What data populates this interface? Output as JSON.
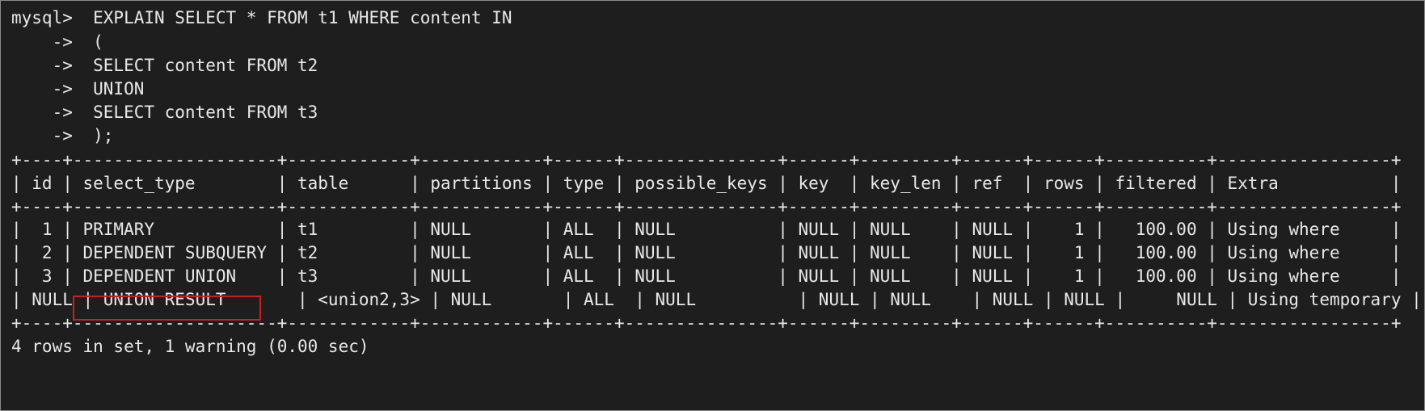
{
  "terminal": {
    "prompt_lines": [
      "mysql>  EXPLAIN SELECT * FROM t1 WHERE content IN",
      "    ->  (",
      "    ->  SELECT content FROM t2",
      "    ->  UNION",
      "    ->  SELECT content FROM t3",
      "    ->  );"
    ],
    "table": {
      "border_top": "+----+--------------------+------------+------------+------+---------------+------+---------+------+------+----------+-----------------+",
      "header": "| id | select_type        | table      | partitions | type | possible_keys | key  | key_len | ref  | rows | filtered | Extra           |",
      "border_mid": "+----+--------------------+------------+------------+------+---------------+------+---------+------+------+----------+-----------------+",
      "rows": [
        "|  1 | PRIMARY            | t1         | NULL       | ALL  | NULL          | NULL | NULL    | NULL |    1 |   100.00 | Using where     |",
        "|  2 | DEPENDENT SUBQUERY | t2         | NULL       | ALL  | NULL          | NULL | NULL    | NULL |    1 |   100.00 | Using where     |",
        "|  3 | DEPENDENT UNION    | t3         | NULL       | ALL  | NULL          | NULL | NULL    | NULL |    1 |   100.00 | Using where     |",
        "| NULL | UNION RESULT       | <union2,3> | NULL       | ALL  | NULL          | NULL | NULL    | NULL | NULL |     NULL | Using temporary |"
      ],
      "border_bottom": "+----+--------------------+------------+------------+------+---------------+------+---------+------+------+----------+-----------------+"
    },
    "summary": "4 rows in set, 1 warning (0.00 sec)",
    "highlight_color": "#c8201d"
  }
}
